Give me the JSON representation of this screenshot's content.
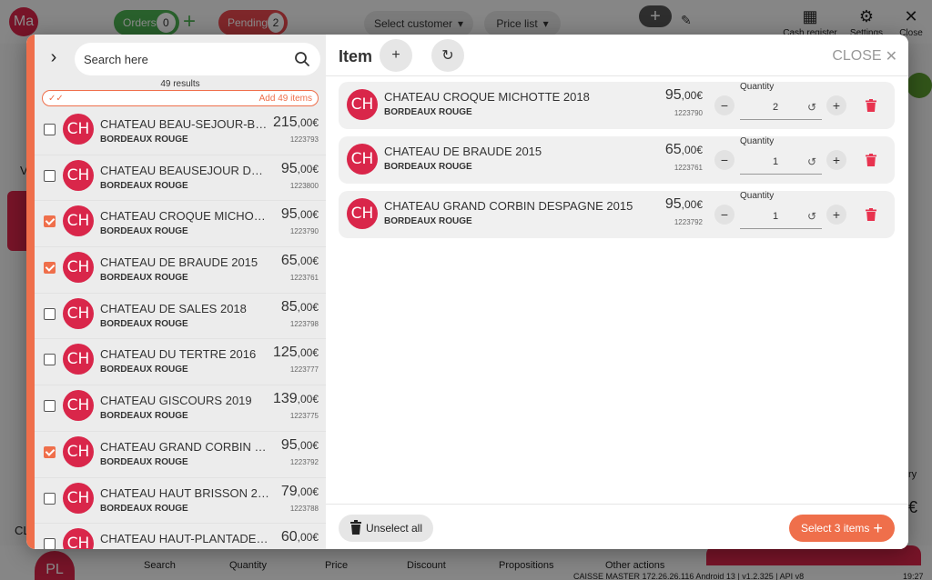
{
  "background": {
    "avatar_initials": "Ma",
    "orders_label": "Orders",
    "orders_count": "0",
    "pending_label": "Pending",
    "pending_count": "2",
    "select_customer": "Select customer",
    "price_list": "Price list",
    "cash_register": "Cash register",
    "settings": "Settings",
    "close": "Close",
    "left_label": "V",
    "left_bottom_label": "CL",
    "right_label_ry": "ry",
    "right_euro": "€",
    "bottom_avatar": "PL",
    "nav": [
      "Search",
      "Quantity",
      "Price",
      "Discount",
      "Propositions",
      "Other actions"
    ],
    "status": "CAISSE MASTER   172.26.26.116   Android 13 | v1.2.325 | API v8",
    "time": "19:27"
  },
  "left": {
    "search_placeholder": "Search here",
    "results": "49 results",
    "add_all": "Add 49 items",
    "items": [
      {
        "initials": "CH",
        "name": "CHATEAU BEAU-SEJOUR-BECOT ...",
        "category": "BORDEAUX ROUGE",
        "price_int": "215",
        "price_dec": ",00€",
        "sku": "1223793",
        "selected": false
      },
      {
        "initials": "CH",
        "name": "CHATEAU BEAUSEJOUR DE BON...",
        "category": "BORDEAUX ROUGE",
        "price_int": "95",
        "price_dec": ",00€",
        "sku": "1223800",
        "selected": false
      },
      {
        "initials": "CH",
        "name": "CHATEAU CROQUE MICHOTTE 2...",
        "category": "BORDEAUX ROUGE",
        "price_int": "95",
        "price_dec": ",00€",
        "sku": "1223790",
        "selected": true
      },
      {
        "initials": "CH",
        "name": "CHATEAU DE BRAUDE 2015",
        "category": "BORDEAUX ROUGE",
        "price_int": "65",
        "price_dec": ",00€",
        "sku": "1223761",
        "selected": true
      },
      {
        "initials": "CH",
        "name": "CHATEAU DE SALES 2018",
        "category": "BORDEAUX ROUGE",
        "price_int": "85",
        "price_dec": ",00€",
        "sku": "1223798",
        "selected": false
      },
      {
        "initials": "CH",
        "name": "CHATEAU DU TERTRE 2016",
        "category": "BORDEAUX ROUGE",
        "price_int": "125",
        "price_dec": ",00€",
        "sku": "1223777",
        "selected": false
      },
      {
        "initials": "CH",
        "name": "CHATEAU GISCOURS 2019",
        "category": "BORDEAUX ROUGE",
        "price_int": "139",
        "price_dec": ",00€",
        "sku": "1223775",
        "selected": false
      },
      {
        "initials": "CH",
        "name": "CHATEAU GRAND CORBIN DESP...",
        "category": "BORDEAUX ROUGE",
        "price_int": "95",
        "price_dec": ",00€",
        "sku": "1223792",
        "selected": true
      },
      {
        "initials": "CH",
        "name": "CHATEAU HAUT BRISSON 2019",
        "category": "BORDEAUX ROUGE",
        "price_int": "79",
        "price_dec": ",00€",
        "sku": "1223788",
        "selected": false
      },
      {
        "initials": "CH",
        "name": "CHATEAU HAUT-PLANTADE 2016",
        "category": "BORDEAUX ROUGE",
        "price_int": "60",
        "price_dec": ",00€",
        "sku": "",
        "selected": false
      }
    ]
  },
  "right": {
    "title": "Item",
    "close_label": "CLOSE",
    "qty_label": "Quantity",
    "items": [
      {
        "initials": "CH",
        "name": "CHATEAU CROQUE MICHOTTE 2018",
        "category": "BORDEAUX ROUGE",
        "price_int": "95",
        "price_dec": ",00€",
        "sku": "1223790",
        "quantity": "2"
      },
      {
        "initials": "CH",
        "name": "CHATEAU DE BRAUDE 2015",
        "category": "BORDEAUX ROUGE",
        "price_int": "65",
        "price_dec": ",00€",
        "sku": "1223761",
        "quantity": "1"
      },
      {
        "initials": "CH",
        "name": "CHATEAU GRAND CORBIN DESPAGNE 2015",
        "category": "BORDEAUX ROUGE",
        "price_int": "95",
        "price_dec": ",00€",
        "sku": "1223792",
        "quantity": "1"
      }
    ],
    "unselect_all": "Unselect all",
    "select_items": "Select 3 items"
  },
  "colors": {
    "accent": "#ef6f4b",
    "brand": "#d9264a",
    "delete": "#e8334f"
  }
}
